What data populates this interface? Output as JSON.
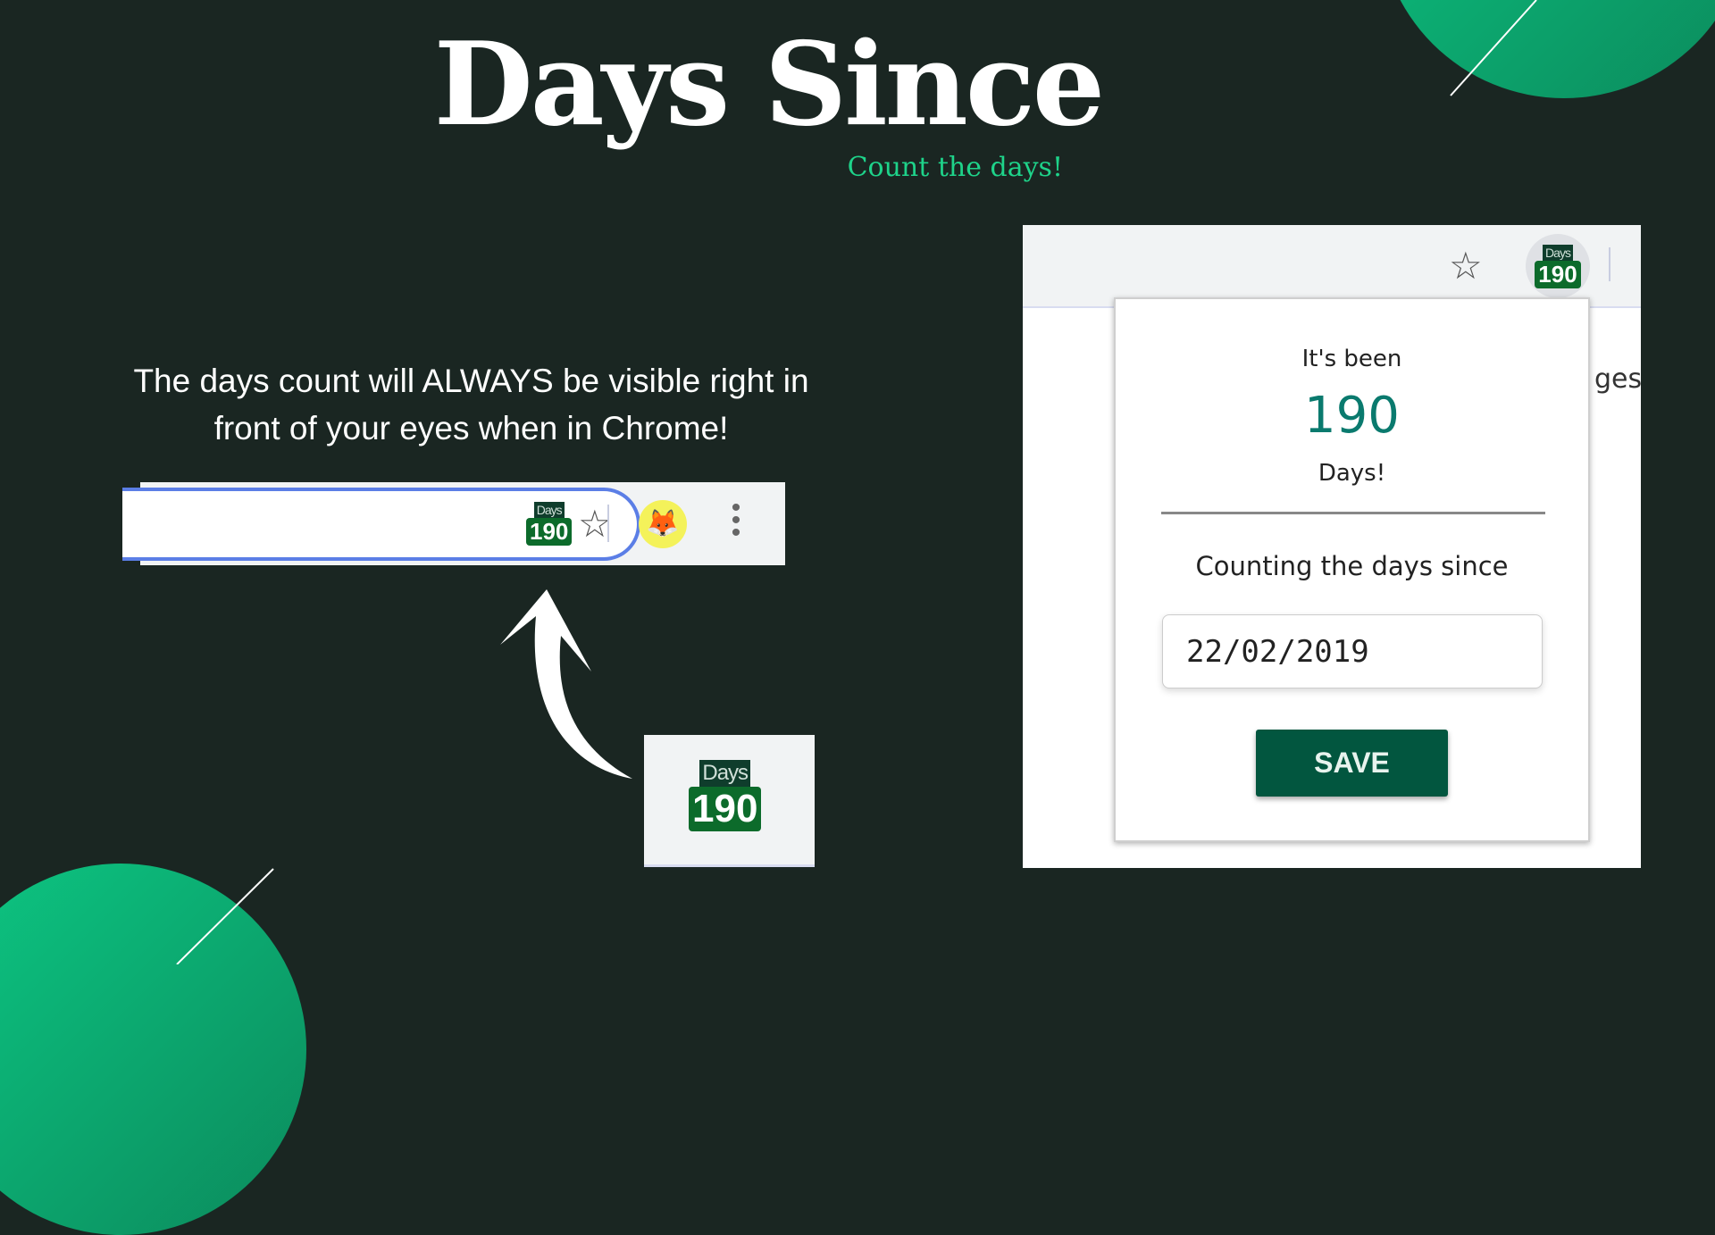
{
  "header": {
    "title": "Days Since",
    "subtitle": "Count the days!"
  },
  "description": {
    "line1": "The days count will ALWAYS be visible right in",
    "line2": "front of your eyes when in Chrome!"
  },
  "badge": {
    "label": "Days",
    "count": "190"
  },
  "popup": {
    "intro": "It's been",
    "count": "190",
    "unit": "Days!",
    "counting_label": "Counting the days since",
    "date_value": "22/02/2019",
    "save_label": "SAVE"
  },
  "background_page": {
    "partial_text": "ges"
  },
  "colors": {
    "background": "#1a2622",
    "accent": "#1ed38a",
    "button": "#02563f",
    "count": "#0a7a6e"
  }
}
